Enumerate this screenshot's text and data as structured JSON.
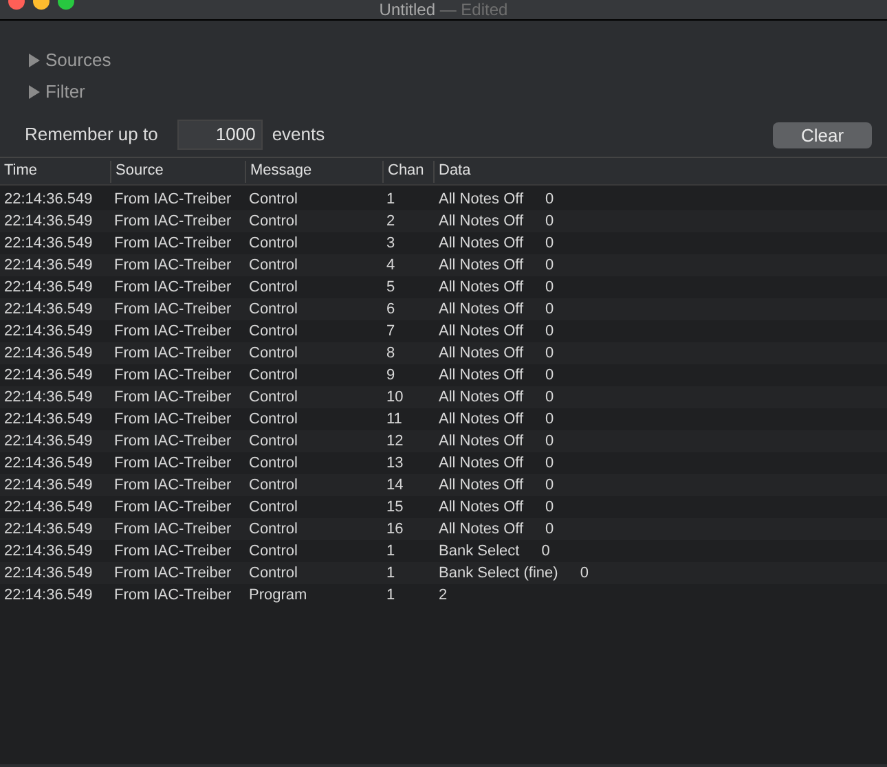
{
  "window": {
    "title": "Untitled",
    "title_suffix": "— Edited"
  },
  "disclosures": [
    {
      "label": "Sources",
      "expanded": false
    },
    {
      "label": "Filter",
      "expanded": false
    }
  ],
  "remember": {
    "label": "Remember up to",
    "value": "1000",
    "unit": "events"
  },
  "clear_button": "Clear",
  "table": {
    "columns": [
      "Time",
      "Source",
      "Message",
      "Chan",
      "Data"
    ],
    "rows": [
      {
        "time": "22:14:36.549",
        "source": "From IAC-Treiber",
        "message": "Control",
        "chan": "1",
        "data": "All Notes Off",
        "value": "0"
      },
      {
        "time": "22:14:36.549",
        "source": "From IAC-Treiber",
        "message": "Control",
        "chan": "2",
        "data": "All Notes Off",
        "value": "0"
      },
      {
        "time": "22:14:36.549",
        "source": "From IAC-Treiber",
        "message": "Control",
        "chan": "3",
        "data": "All Notes Off",
        "value": "0"
      },
      {
        "time": "22:14:36.549",
        "source": "From IAC-Treiber",
        "message": "Control",
        "chan": "4",
        "data": "All Notes Off",
        "value": "0"
      },
      {
        "time": "22:14:36.549",
        "source": "From IAC-Treiber",
        "message": "Control",
        "chan": "5",
        "data": "All Notes Off",
        "value": "0"
      },
      {
        "time": "22:14:36.549",
        "source": "From IAC-Treiber",
        "message": "Control",
        "chan": "6",
        "data": "All Notes Off",
        "value": "0"
      },
      {
        "time": "22:14:36.549",
        "source": "From IAC-Treiber",
        "message": "Control",
        "chan": "7",
        "data": "All Notes Off",
        "value": "0"
      },
      {
        "time": "22:14:36.549",
        "source": "From IAC-Treiber",
        "message": "Control",
        "chan": "8",
        "data": "All Notes Off",
        "value": "0"
      },
      {
        "time": "22:14:36.549",
        "source": "From IAC-Treiber",
        "message": "Control",
        "chan": "9",
        "data": "All Notes Off",
        "value": "0"
      },
      {
        "time": "22:14:36.549",
        "source": "From IAC-Treiber",
        "message": "Control",
        "chan": "10",
        "data": "All Notes Off",
        "value": "0"
      },
      {
        "time": "22:14:36.549",
        "source": "From IAC-Treiber",
        "message": "Control",
        "chan": "11",
        "data": "All Notes Off",
        "value": "0"
      },
      {
        "time": "22:14:36.549",
        "source": "From IAC-Treiber",
        "message": "Control",
        "chan": "12",
        "data": "All Notes Off",
        "value": "0"
      },
      {
        "time": "22:14:36.549",
        "source": "From IAC-Treiber",
        "message": "Control",
        "chan": "13",
        "data": "All Notes Off",
        "value": "0"
      },
      {
        "time": "22:14:36.549",
        "source": "From IAC-Treiber",
        "message": "Control",
        "chan": "14",
        "data": "All Notes Off",
        "value": "0"
      },
      {
        "time": "22:14:36.549",
        "source": "From IAC-Treiber",
        "message": "Control",
        "chan": "15",
        "data": "All Notes Off",
        "value": "0"
      },
      {
        "time": "22:14:36.549",
        "source": "From IAC-Treiber",
        "message": "Control",
        "chan": "16",
        "data": "All Notes Off",
        "value": "0"
      },
      {
        "time": "22:14:36.549",
        "source": "From IAC-Treiber",
        "message": "Control",
        "chan": "1",
        "data": "Bank Select",
        "value": "0"
      },
      {
        "time": "22:14:36.549",
        "source": "From IAC-Treiber",
        "message": "Control",
        "chan": "1",
        "data": "Bank Select (fine)",
        "value": "0"
      },
      {
        "time": "22:14:36.549",
        "source": "From IAC-Treiber",
        "message": "Program",
        "chan": "1",
        "data": "2"
      }
    ]
  }
}
